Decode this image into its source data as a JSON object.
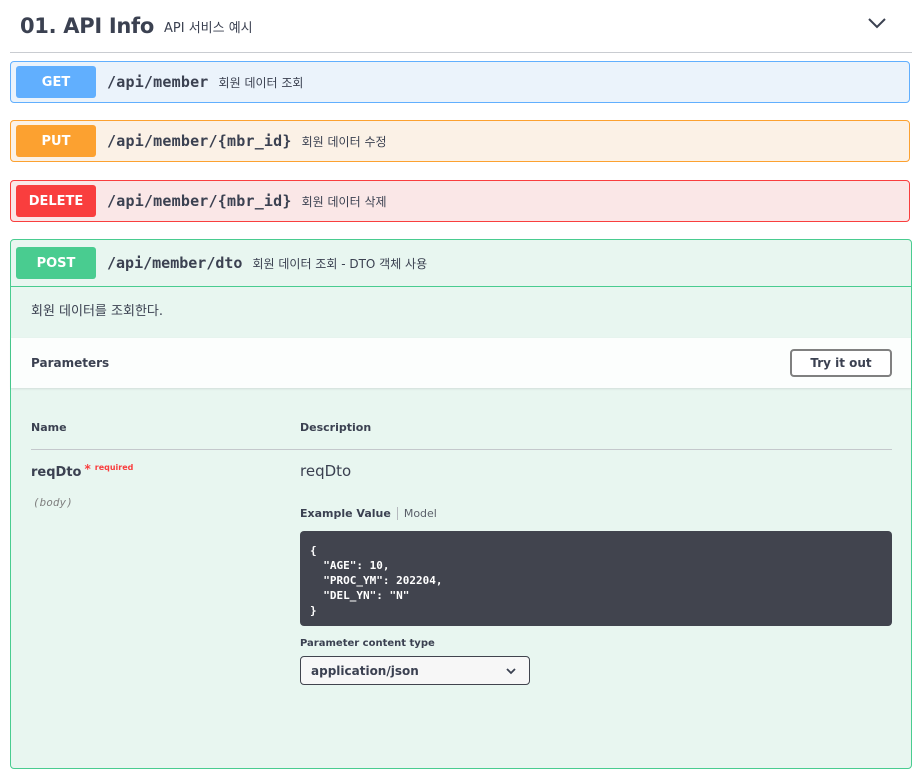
{
  "tag": {
    "title": "01. API Info",
    "description": "API 서비스 예시"
  },
  "operations": [
    {
      "method": "GET",
      "path": "/api/member",
      "summary": "회원 데이터 조회",
      "color": "#61affe"
    },
    {
      "method": "PUT",
      "path": "/api/member/{mbr_id}",
      "summary": "회원 데이터 수정",
      "color": "#fca130"
    },
    {
      "method": "DELETE",
      "path": "/api/member/{mbr_id}",
      "summary": "회원 데이터 삭제",
      "color": "#f93e3e"
    }
  ],
  "expanded": {
    "method": "POST",
    "path": "/api/member/dto",
    "summary": "회원 데이터 조회 - DTO 객체 사용",
    "color": "#49cc90",
    "description": "회원 데이터를 조회한다.",
    "parameters_title": "Parameters",
    "try_button": "Try it out",
    "columns": {
      "name": "Name",
      "description": "Description"
    },
    "param": {
      "name": "reqDto",
      "required_star": "*",
      "required_label": "required",
      "in": "(body)",
      "description": "reqDto"
    },
    "tabs": {
      "example": "Example Value",
      "model": "Model"
    },
    "example_code": "{\n  \"AGE\": 10,\n  \"PROC_YM\": 202204,\n  \"DEL_YN\": \"N\"\n}",
    "content_type_label": "Parameter content type",
    "content_type_value": "application/json"
  }
}
